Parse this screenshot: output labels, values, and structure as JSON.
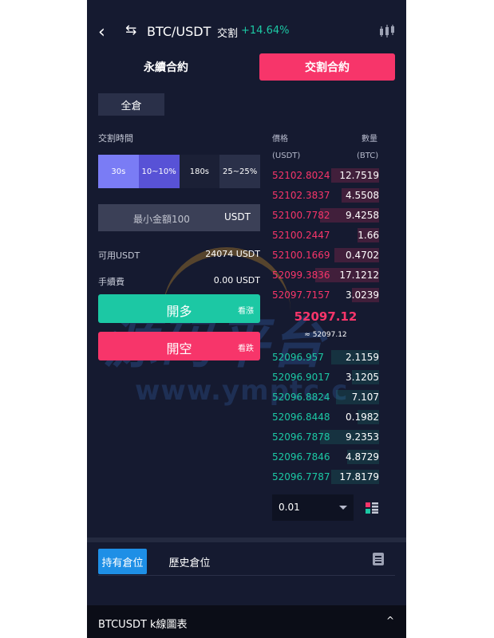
{
  "header": {
    "back_icon": "chevron-left-icon",
    "swap_icon": "swap-arrows-icon",
    "pair": "BTC/USDT",
    "type": "交割",
    "change": "+14.64%",
    "chart_icon": "candlestick-icon"
  },
  "mode_tabs": [
    {
      "label": "永續合約",
      "active": false
    },
    {
      "label": "交割合約",
      "active": true
    }
  ],
  "margin_mode": "全倉",
  "trade": {
    "time_label": "交割時間",
    "time_options": [
      "30s",
      "10~10%",
      "180s",
      "25~25%"
    ],
    "amount_placeholder": "最小金額100",
    "amount_unit": "USDT",
    "available_label": "可用USDT",
    "available_value": "24074 USDT",
    "fee_label": "手續費",
    "fee_value": "0.00 USDT",
    "long_label": "開多",
    "long_sub": "看漲",
    "short_label": "開空",
    "short_sub": "看跌"
  },
  "orderbook": {
    "price_label": "價格",
    "qty_label": "數量",
    "price_unit": "(USDT)",
    "qty_unit": "(BTC)",
    "asks": [
      {
        "price": "52102.8024",
        "qty": "12.7519",
        "depth": 0.45
      },
      {
        "price": "52102.3837",
        "qty": "4.5508",
        "depth": 0.35
      },
      {
        "price": "52100.7782",
        "qty": "9.4258",
        "depth": 0.55
      },
      {
        "price": "52100.2447",
        "qty": "1.66",
        "depth": 0.2
      },
      {
        "price": "52100.1669",
        "qty": "0.4702",
        "depth": 0.42
      },
      {
        "price": "52099.3836",
        "qty": "17.1212",
        "depth": 0.6
      },
      {
        "price": "52097.7157",
        "qty": "3.0239",
        "depth": 0.25
      }
    ],
    "last_price": "52097.12",
    "last_price_sub": "≈ 52097.12",
    "bids": [
      {
        "price": "52096.957",
        "qty": "2.1159",
        "depth": 0.45
      },
      {
        "price": "52096.9017",
        "qty": "3.1205",
        "depth": 0.25
      },
      {
        "price": "52096.8824",
        "qty": "7.107",
        "depth": 0.4
      },
      {
        "price": "52096.8448",
        "qty": "0.1982",
        "depth": 0.2
      },
      {
        "price": "52096.7878",
        "qty": "9.2353",
        "depth": 0.55
      },
      {
        "price": "52096.7846",
        "qty": "4.8729",
        "depth": 0.3
      },
      {
        "price": "52096.7787",
        "qty": "17.8179",
        "depth": 0.45
      }
    ],
    "precision": "0.01",
    "layout_icon": "orderbook-layout-icon"
  },
  "positions": {
    "tabs": [
      "持有倉位",
      "歷史倉位"
    ],
    "doc_icon": "document-icon"
  },
  "bottom": {
    "label": "BTCUSDT  k線圖表",
    "caret": "^"
  },
  "watermark": {
    "logo_text": "源码平台",
    "url": "www.ymptc.c"
  },
  "colors": {
    "background": "#151a30",
    "accent_red": "#f7356a",
    "accent_green": "#1cc8a4",
    "accent_blue": "#1e8fe6",
    "accent_purple": "#5852d6"
  }
}
